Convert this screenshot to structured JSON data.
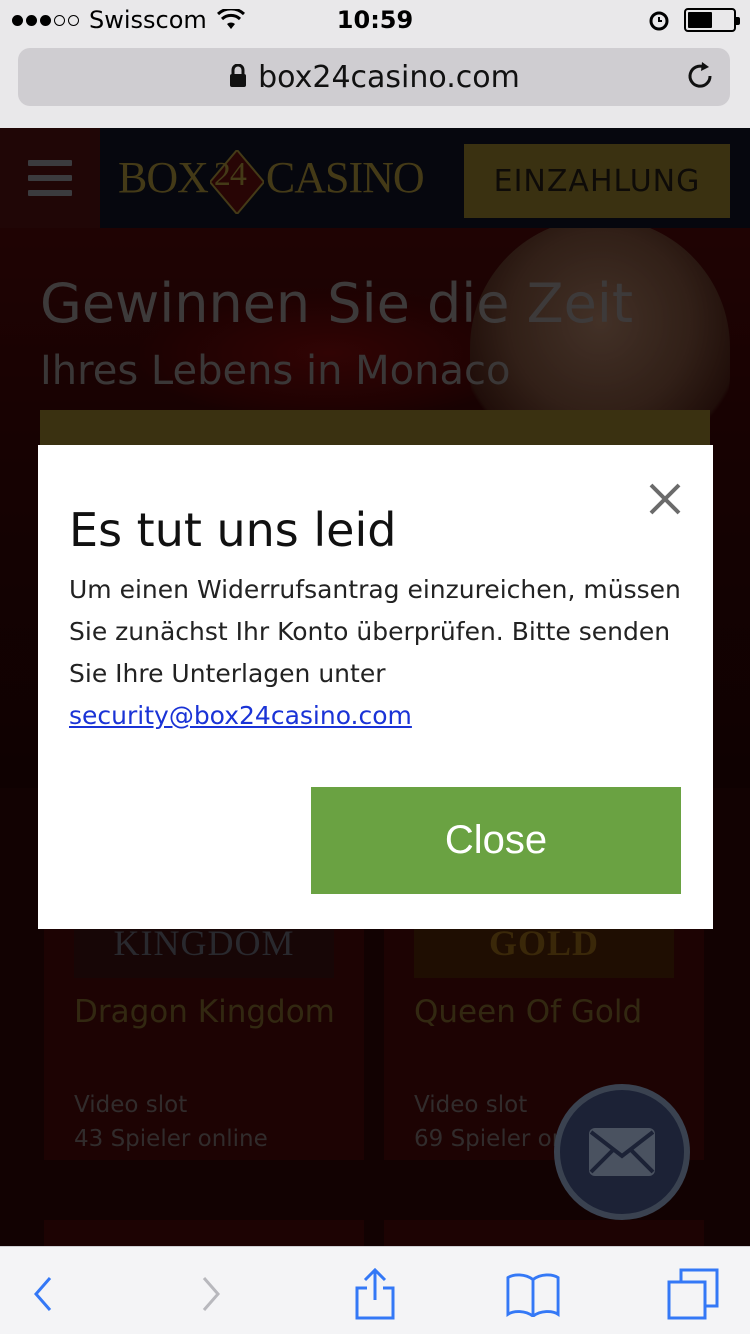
{
  "status_bar": {
    "carrier": "Swisscom",
    "time": "10:59",
    "signal_bars": 3,
    "battery_level": 0.55,
    "icons": [
      "wifi-icon",
      "alarm-icon",
      "battery-icon"
    ]
  },
  "browser": {
    "url": "box24casino.com",
    "lock_icon": "lock-icon",
    "reload_icon": "reload-icon"
  },
  "site_header": {
    "menu_icon": "hamburger-menu-icon",
    "logo_left": "BOX",
    "logo_mid": "24",
    "logo_right": "CASINO",
    "deposit_label": "EINZAHLUNG"
  },
  "hero": {
    "title": "Gewinnen Sie die Zeit",
    "subtitle": "Ihres Lebens in Monaco"
  },
  "games": [
    {
      "thumb_label": "KINGDOM",
      "name": "Dragon Kingdom",
      "type": "Video slot",
      "players": "43 Spieler online"
    },
    {
      "thumb_label": "GOLD",
      "name": "Queen Of Gold",
      "type": "Video slot",
      "players": "69 Spieler online"
    }
  ],
  "modal": {
    "title": "Es tut uns leid",
    "body_text": "Um einen Widerrufsantrag einzureichen, müssen Sie zunächst Ihr Konto überprüfen. Bitte senden Sie Ihre Unterlagen unter ",
    "email_link": "security@box24casino.com",
    "close_button": "Close"
  },
  "colors": {
    "accent_gold": "#6a5a1f",
    "close_green": "#6aa242",
    "link_blue": "#1a33d6",
    "ios_blue": "#3478f6"
  },
  "toolbar": {
    "icons": [
      "back-icon",
      "forward-icon",
      "share-icon",
      "bookmarks-icon",
      "tabs-icon"
    ]
  }
}
